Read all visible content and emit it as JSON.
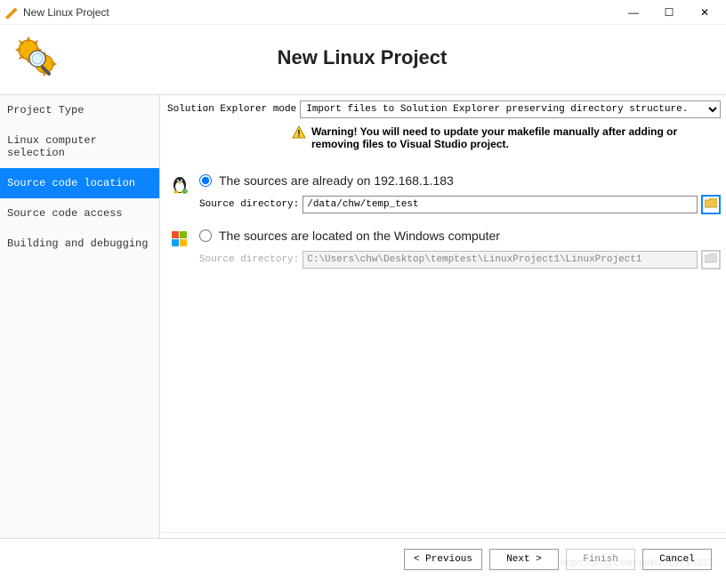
{
  "window": {
    "title": "New Linux Project",
    "min": "—",
    "max": "☐",
    "close": "✕"
  },
  "header": {
    "title": "New Linux Project"
  },
  "sidebar": {
    "items": [
      {
        "label": "Project Type"
      },
      {
        "label": "Linux computer selection"
      },
      {
        "label": "Source code location"
      },
      {
        "label": "Source code access"
      },
      {
        "label": "Building and debugging"
      }
    ],
    "selected_index": 2
  },
  "content": {
    "mode_label": "Solution Explorer mode",
    "mode_value": "Import files to Solution Explorer preserving directory structure.",
    "warning_bold": "Warning! You will need to update your makefile manually after adding or removing files to Visual Studio project.",
    "opt_linux": {
      "label": "The sources are already on 192.168.1.183",
      "dir_label": "Source directory:",
      "dir_value": "/data/chw/temp_test",
      "checked": true
    },
    "opt_windows": {
      "label": "The sources are located on the Windows computer",
      "dir_label": "Source directory:",
      "dir_value": "C:\\Users\\chw\\Desktop\\temptest\\LinuxProject1\\LinuxProject1",
      "checked": false
    }
  },
  "footer": {
    "prev": "< Previous",
    "next": "Next >",
    "finish": "Finish",
    "cancel": "Cancel"
  },
  "watermark": "https://blog.csdn.net/u013716535"
}
